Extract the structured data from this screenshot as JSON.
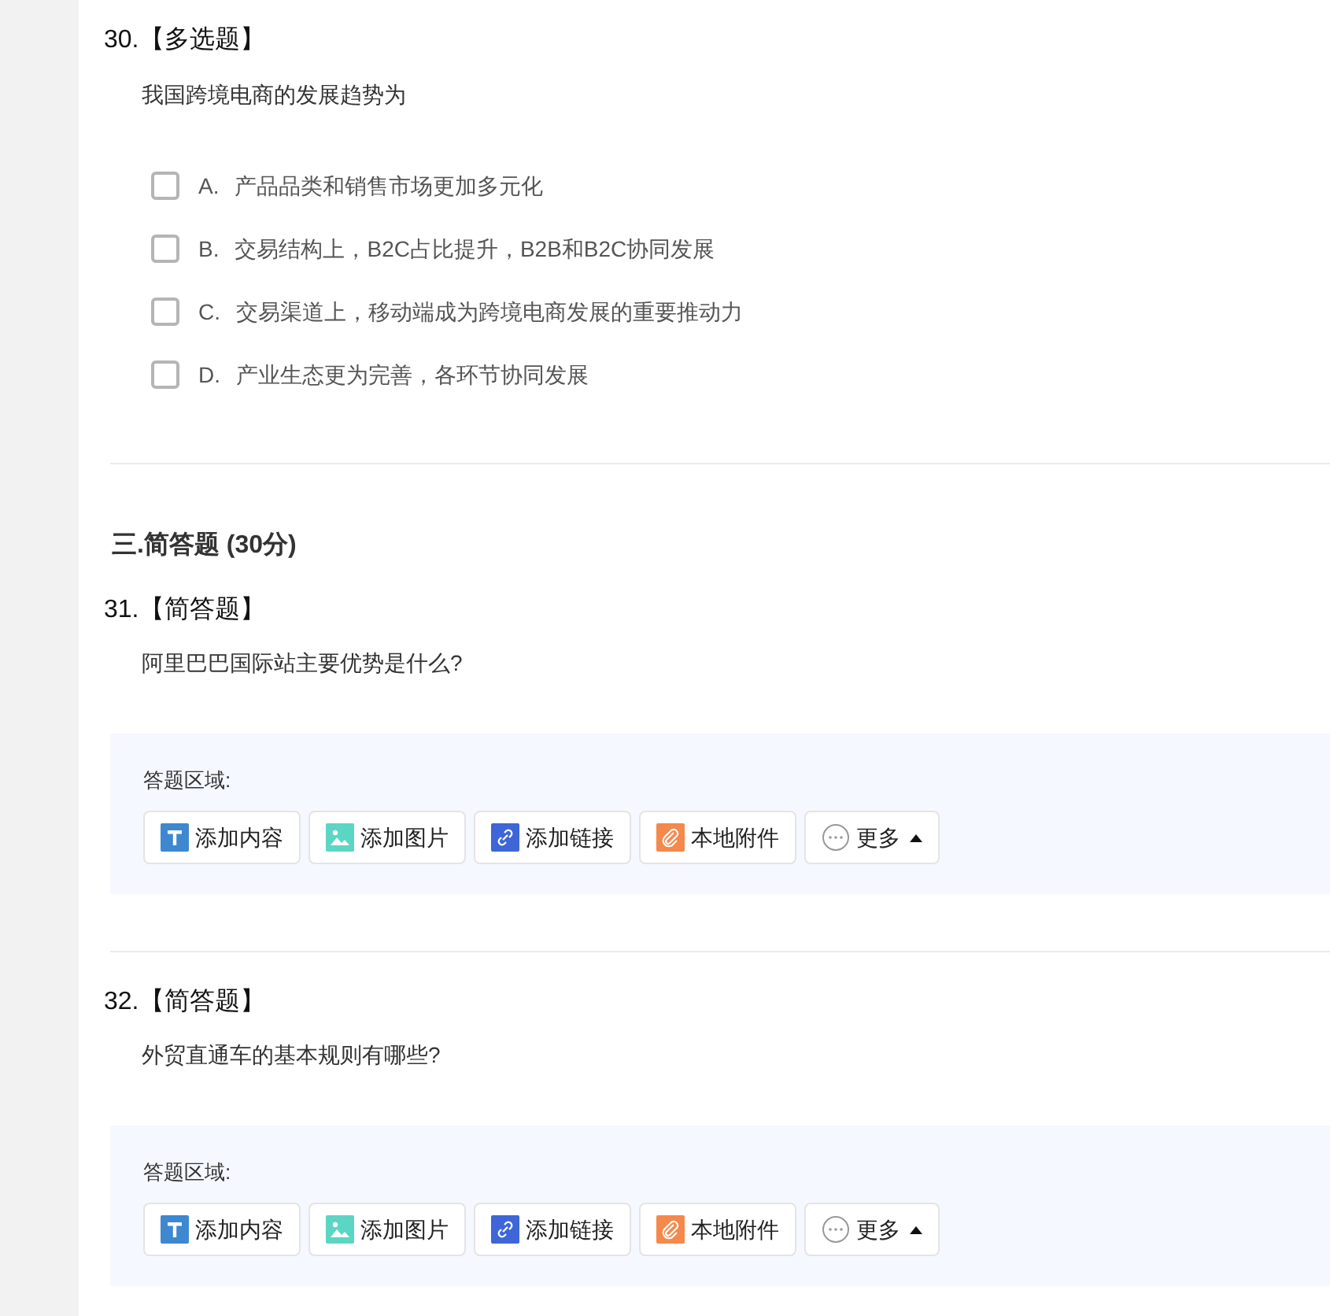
{
  "items": [
    {
      "kind": "multiple_choice",
      "number": "30.",
      "type_label": "【多选题】",
      "stem": "我国跨境电商的发展趋势为",
      "options": [
        {
          "letter": "A.",
          "text": "产品品类和销售市场更加多元化",
          "checked": false
        },
        {
          "letter": "B.",
          "text": "交易结构上，B2C占比提升，B2B和B2C协同发展",
          "checked": false
        },
        {
          "letter": "C.",
          "text": "交易渠道上，移动端成为跨境电商发展的重要推动力",
          "checked": false
        },
        {
          "letter": "D.",
          "text": "产业生态更为完善，各环节协同发展",
          "checked": false
        }
      ]
    },
    {
      "kind": "section_heading",
      "title": "三.简答题 (30分)"
    },
    {
      "kind": "short_answer",
      "number": "31.",
      "type_label": "【简答题】",
      "stem": "阿里巴巴国际站主要优势是什么?",
      "answer_label": "答题区域:",
      "tools": [
        {
          "kind": "text",
          "label": "添加内容"
        },
        {
          "kind": "image",
          "label": "添加图片"
        },
        {
          "kind": "link",
          "label": "添加链接"
        },
        {
          "kind": "attachment",
          "label": "本地附件"
        },
        {
          "kind": "more",
          "label": "更多"
        }
      ]
    },
    {
      "kind": "short_answer",
      "number": "32.",
      "type_label": "【简答题】",
      "stem": "外贸直通车的基本规则有哪些?",
      "answer_label": "答题区域:",
      "tools": [
        {
          "kind": "text",
          "label": "添加内容"
        },
        {
          "kind": "image",
          "label": "添加图片"
        },
        {
          "kind": "link",
          "label": "添加链接"
        },
        {
          "kind": "attachment",
          "label": "本地附件"
        },
        {
          "kind": "more",
          "label": "更多"
        }
      ]
    }
  ]
}
